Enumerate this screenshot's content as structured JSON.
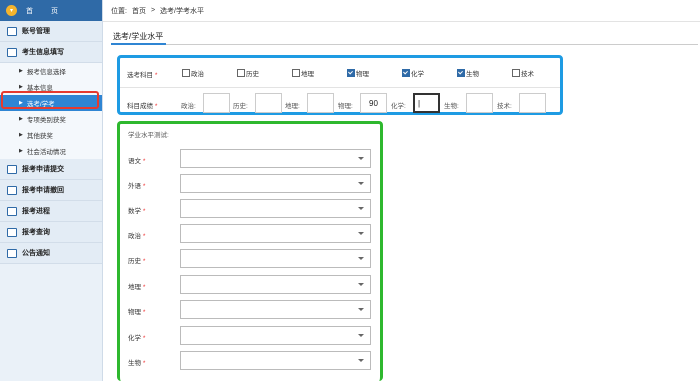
{
  "sidebar": {
    "home": {
      "label_left": "首",
      "label_right": "页"
    },
    "items": [
      {
        "label": "账号管理",
        "icon": "account-icon"
      },
      {
        "label": "考生信息填写",
        "icon": "edit-icon",
        "children": [
          {
            "label": "报考信息选择"
          },
          {
            "label": "基本信息"
          },
          {
            "label": "选考/学考",
            "active": true
          },
          {
            "label": "专项类别获奖"
          },
          {
            "label": "其他获奖"
          },
          {
            "label": "社会活动情况"
          }
        ]
      },
      {
        "label": "报考申请提交",
        "icon": "submit-icon"
      },
      {
        "label": "报考申请撤回",
        "icon": "withdraw-icon"
      },
      {
        "label": "报考进程",
        "icon": "progress-icon"
      },
      {
        "label": "报考查询",
        "icon": "query-icon"
      },
      {
        "label": "公告通知",
        "icon": "notice-icon"
      }
    ]
  },
  "breadcrumb": {
    "prefix": "位置:",
    "home": "首页",
    "sep": ">",
    "current": "选考/学考水平"
  },
  "page_title": "选考/学业水平",
  "subjects": {
    "label": "选考科目",
    "required_mark": "*",
    "options": [
      {
        "name": "政治",
        "checked": false
      },
      {
        "name": "历史",
        "checked": false
      },
      {
        "name": "地理",
        "checked": false
      },
      {
        "name": "物理",
        "checked": true
      },
      {
        "name": "化学",
        "checked": true
      },
      {
        "name": "生物",
        "checked": true
      },
      {
        "name": "技术",
        "checked": false
      }
    ]
  },
  "scores": {
    "label": "科目成绩",
    "required_mark": "*",
    "fields": [
      {
        "name": "政治:",
        "value": ""
      },
      {
        "name": "历史:",
        "value": ""
      },
      {
        "name": "地理:",
        "value": ""
      },
      {
        "name": "物理:",
        "value": "90"
      },
      {
        "name": "化学:",
        "value": "|"
      },
      {
        "name": "生物:",
        "value": ""
      },
      {
        "name": "技术:",
        "value": ""
      }
    ]
  },
  "level_test": {
    "title": "学业水平测试:",
    "required_mark": "*",
    "rows": [
      {
        "name": "语文",
        "value": ""
      },
      {
        "name": "外语",
        "value": ""
      },
      {
        "name": "数学",
        "value": ""
      },
      {
        "name": "政治",
        "value": ""
      },
      {
        "name": "历史",
        "value": ""
      },
      {
        "name": "地理",
        "value": ""
      },
      {
        "name": "物理",
        "value": ""
      },
      {
        "name": "化学",
        "value": ""
      },
      {
        "name": "生物",
        "value": ""
      }
    ]
  },
  "colors": {
    "highlight_red": "#e63a2e",
    "highlight_blue": "#1e9be3",
    "highlight_green": "#2eb82e",
    "nav_active": "#2f85d3"
  }
}
